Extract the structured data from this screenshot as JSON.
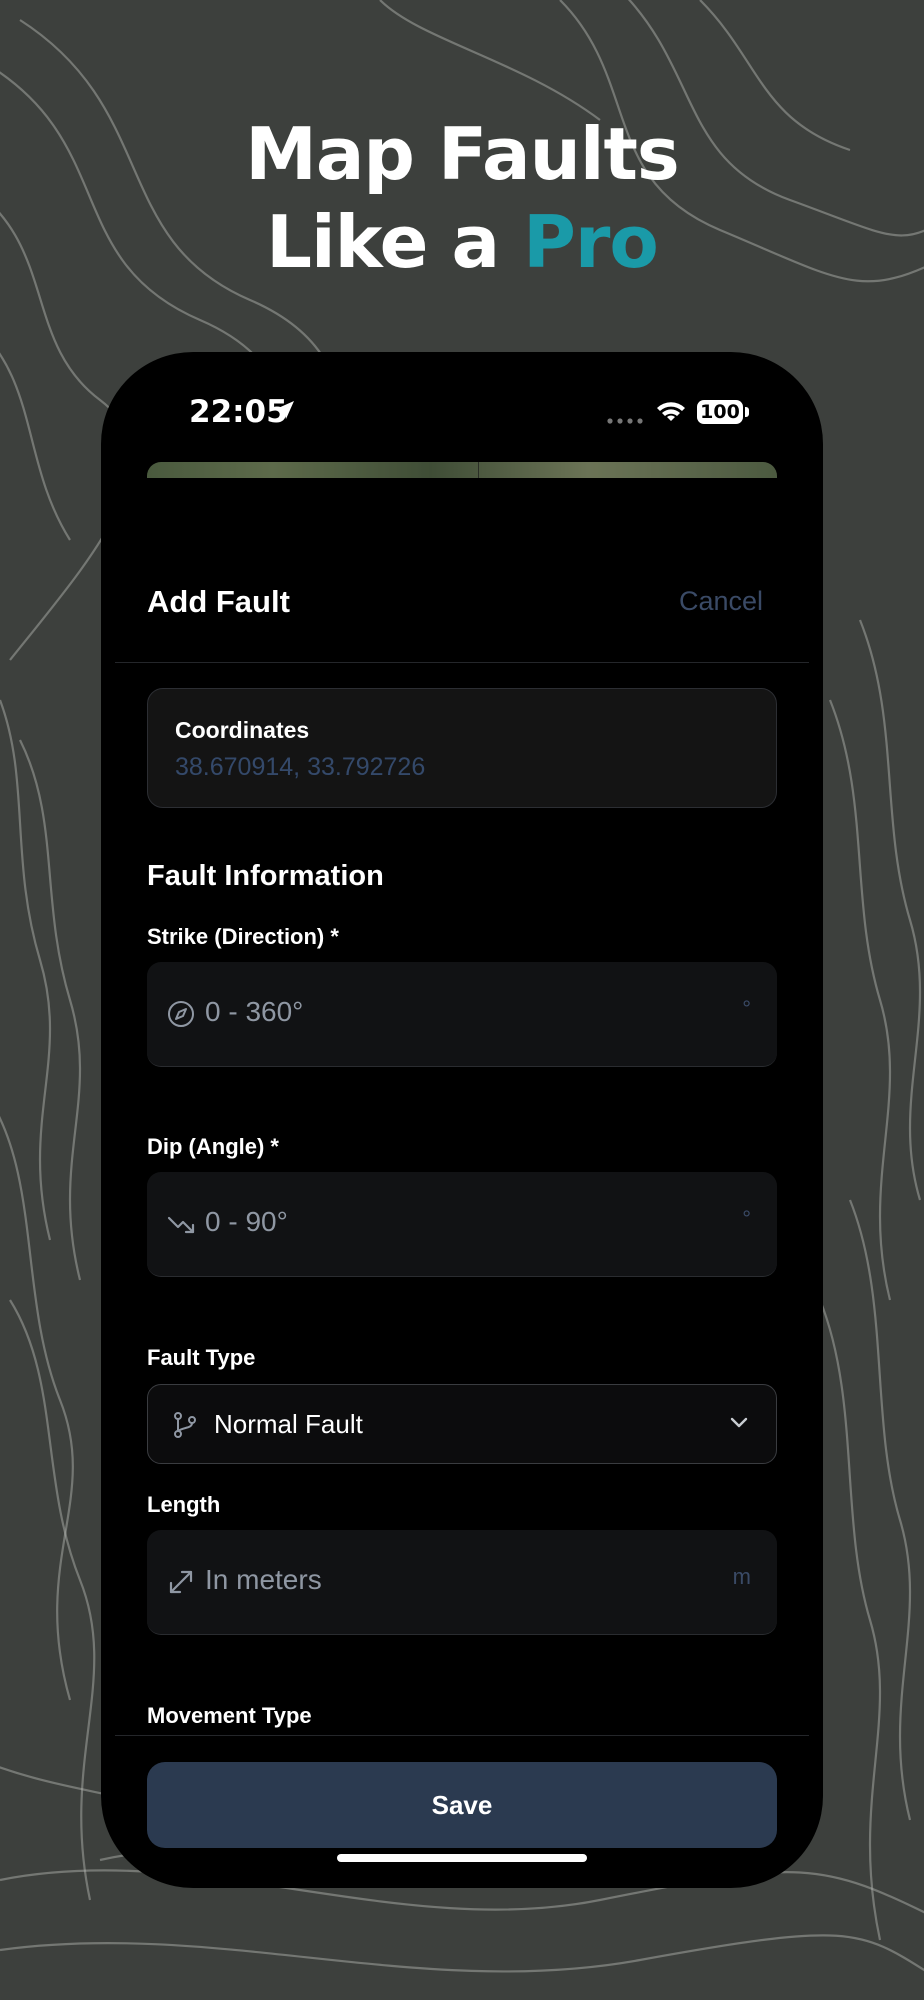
{
  "promo": {
    "headline_line1": "Map Faults",
    "headline_line2_prefix": "Like a",
    "headline_line2_highlight": "Pro",
    "highlight_color": "#1a9aa8"
  },
  "status_bar": {
    "time": "22:05",
    "battery": "100",
    "icons": [
      "location-arrow-icon",
      "signal-dots-icon",
      "wifi-icon",
      "battery-icon"
    ]
  },
  "sheet": {
    "title": "Add Fault",
    "cancel_label": "Cancel"
  },
  "coordinates": {
    "label": "Coordinates",
    "value": "38.670914, 33.792726"
  },
  "fault_info": {
    "section_title": "Fault Information",
    "strike": {
      "label": "Strike (Direction) *",
      "placeholder": "0 - 360°",
      "unit": "°",
      "icon": "compass-icon"
    },
    "dip": {
      "label": "Dip (Angle) *",
      "placeholder": "0 - 90°",
      "unit": "°",
      "icon": "trend-down-icon"
    },
    "fault_type": {
      "label": "Fault Type",
      "value": "Normal Fault",
      "icon": "git-branch-icon"
    },
    "length": {
      "label": "Length",
      "placeholder": "In meters",
      "unit": "m",
      "icon": "diagonal-resize-icon"
    },
    "movement_type": {
      "label": "Movement Type"
    }
  },
  "footer": {
    "save_label": "Save"
  },
  "colors": {
    "accent_muted": "#3a4a66",
    "save_button": "#2b3a50",
    "background": "#000000"
  }
}
